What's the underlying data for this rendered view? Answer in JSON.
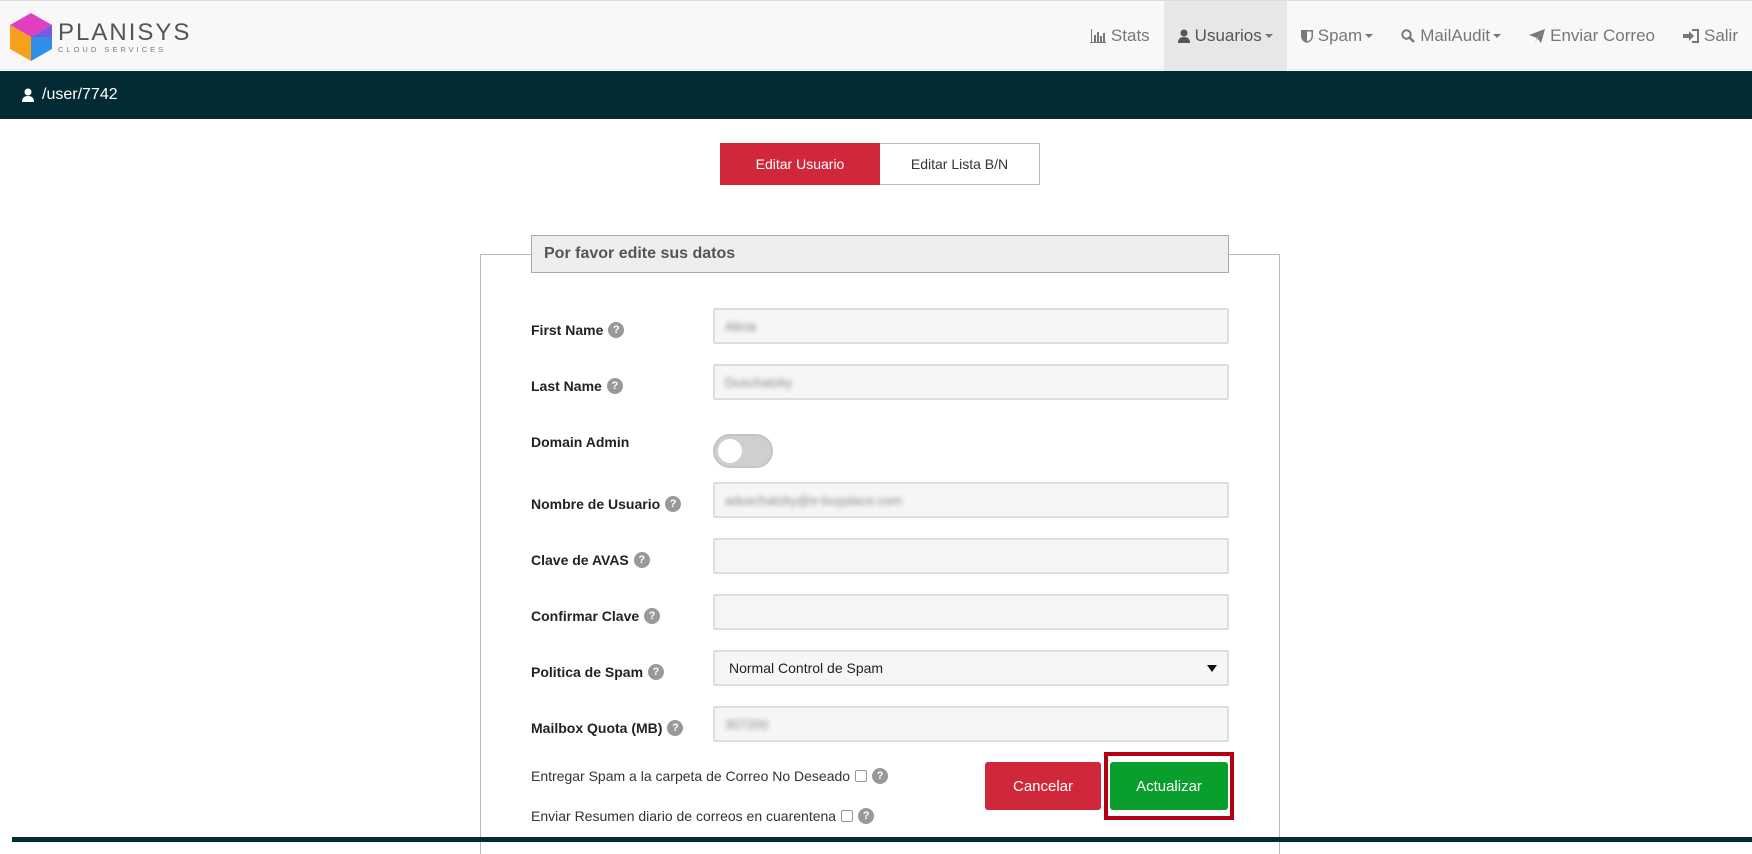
{
  "brand": {
    "name": "PLANISYS",
    "sub": "CLOUD SERVICES"
  },
  "nav": {
    "items": [
      {
        "label": "Stats",
        "icon": "bar-chart-icon",
        "dropdown": false,
        "active": false
      },
      {
        "label": "Usuarios",
        "icon": "user-icon",
        "dropdown": true,
        "active": true
      },
      {
        "label": "Spam",
        "icon": "shield-icon",
        "dropdown": true,
        "active": false
      },
      {
        "label": "MailAudit",
        "icon": "search-icon",
        "dropdown": true,
        "active": false
      },
      {
        "label": "Enviar Correo",
        "icon": "paper-plane-icon",
        "dropdown": false,
        "active": false
      },
      {
        "label": "Salir",
        "icon": "sign-in-icon",
        "dropdown": false,
        "active": false
      }
    ]
  },
  "path": {
    "text": "/user/7742",
    "icon": "user-icon"
  },
  "tabs": {
    "edit_user": "Editar Usuario",
    "edit_list": "Editar Lista B/N"
  },
  "form": {
    "legend": "Por favor edite sus datos",
    "first_name": {
      "label": "First Name",
      "value": "Alicia"
    },
    "last_name": {
      "label": "Last Name",
      "value": "Duschatzky"
    },
    "domain_admin": {
      "label": "Domain Admin",
      "enabled": false
    },
    "username": {
      "label": "Nombre de Usuario",
      "value": "aduschatzky@e-buyplace.com"
    },
    "password": {
      "label": "Clave de AVAS",
      "value": ""
    },
    "confirm_password": {
      "label": "Confirmar Clave",
      "value": ""
    },
    "spam_policy": {
      "label": "Politica de Spam",
      "value": "Normal Control de Spam"
    },
    "quota": {
      "label": "Mailbox Quota (MB)",
      "value": "307200"
    },
    "deliver_spam": {
      "label": "Entregar Spam a la carpeta de Correo No Deseado",
      "checked": false
    },
    "daily_summary": {
      "label": "Enviar Resumen diario de correos en cuarentena",
      "checked": false
    },
    "cancel": "Cancelar",
    "update": "Actualizar"
  },
  "colors": {
    "accent_red": "#d0283a",
    "accent_green": "#0a9e2c",
    "dark_bar": "#032b33"
  }
}
